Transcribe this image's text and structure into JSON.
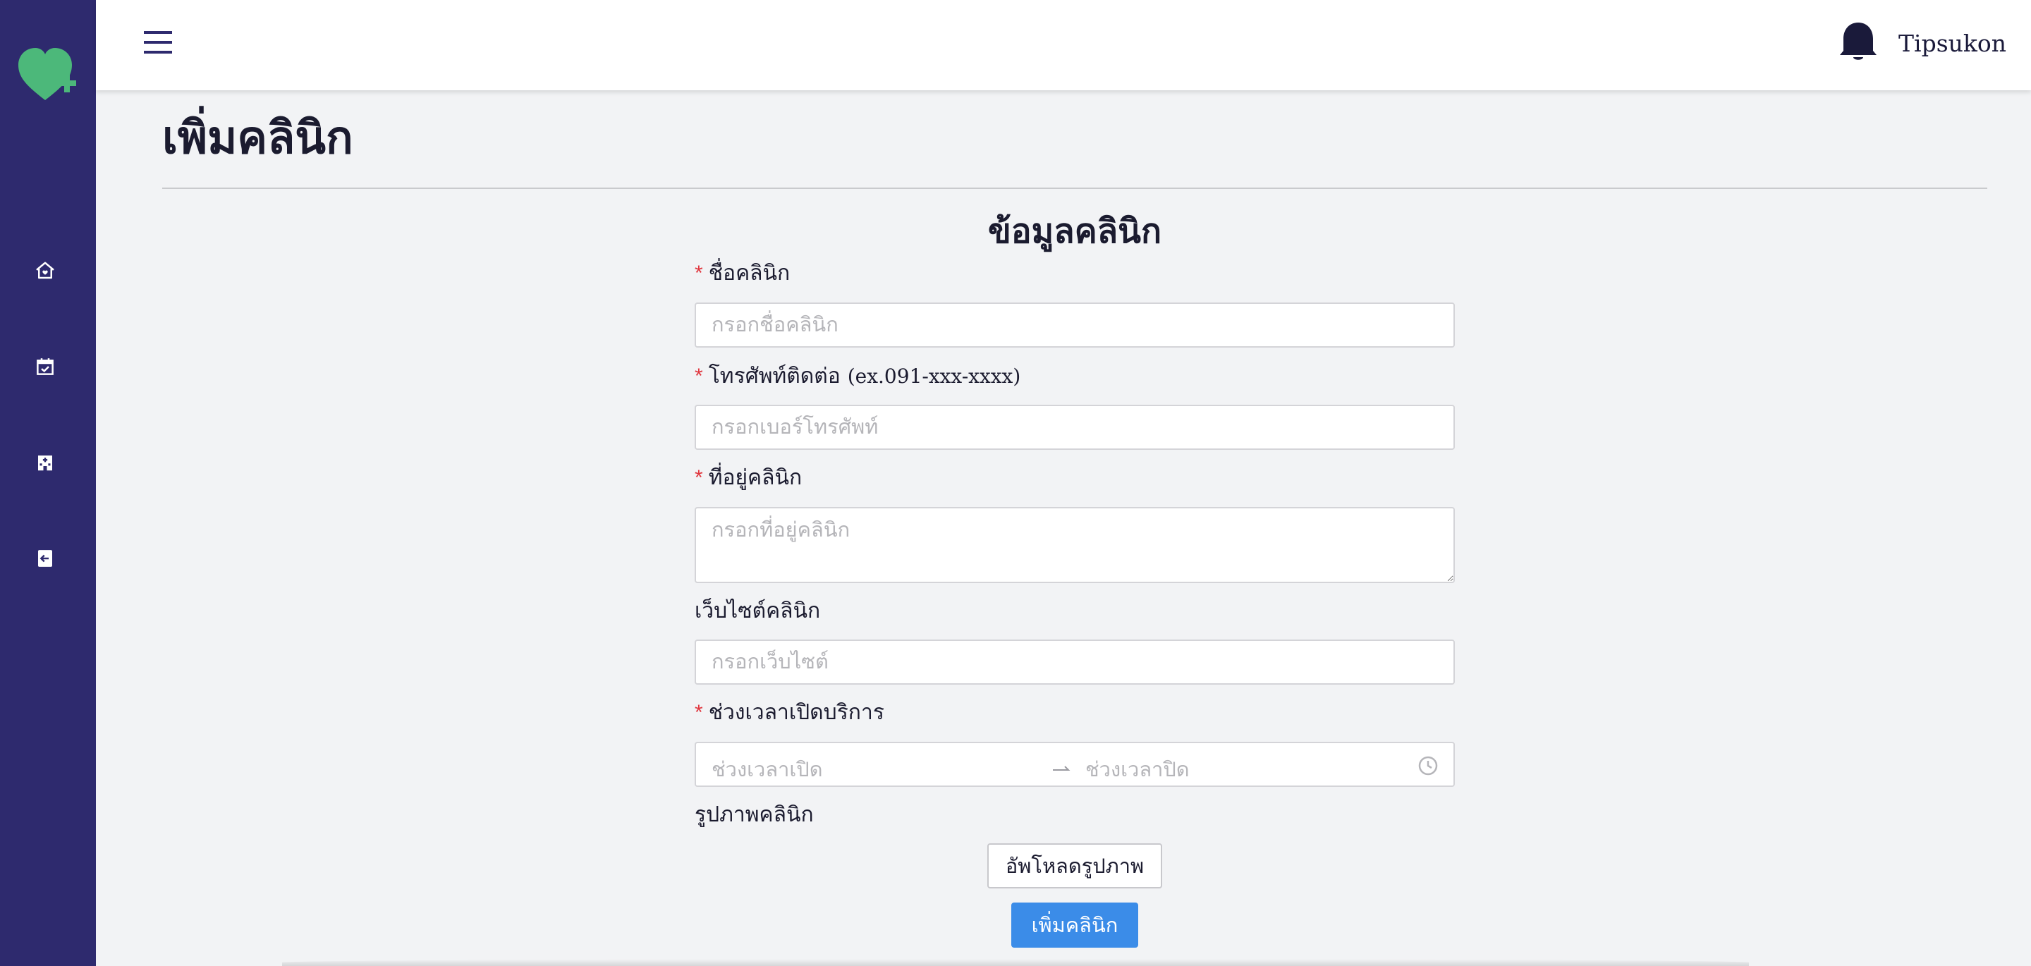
{
  "header": {
    "username": "Tipsukon"
  },
  "sidebar": {
    "items": [
      {
        "icon": "home-icon"
      },
      {
        "icon": "calendar-check-icon"
      },
      {
        "icon": "building-icon"
      },
      {
        "icon": "logout-icon"
      }
    ]
  },
  "page": {
    "title": "เพิ่มคลินิก"
  },
  "form": {
    "title": "ข้อมูลคลินิก",
    "required_mark": "*",
    "clinic_name": {
      "label": "ชื่อคลินิก",
      "placeholder": "กรอกชื่อคลินิก"
    },
    "phone": {
      "label": "โทรศัพท์ติดต่อ",
      "hint": "(ex.091-xxx-xxxx)",
      "placeholder": "กรอกเบอร์โทรศัพท์"
    },
    "address": {
      "label": "ที่อยู่คลินิก",
      "placeholder": "กรอกที่อยู่คลินิก"
    },
    "website": {
      "label": "เว็บไซต์คลินิก",
      "placeholder": "กรอกเว็บไซต์"
    },
    "hours": {
      "label": "ช่วงเวลาเปิดบริการ",
      "start_placeholder": "ช่วงเวลาเปิด",
      "end_placeholder": "ช่วงเวลาปิด"
    },
    "image": {
      "label": "รูปภาพคลินิก",
      "upload_label": "อัพโหลดรูปภาพ"
    },
    "submit_label": "เพิ่มคลินิก"
  },
  "colors": {
    "sidebar": "#2e2a6e",
    "logo": "#4cb87a",
    "accent": "#3b8ce8",
    "required": "#e0363e"
  }
}
